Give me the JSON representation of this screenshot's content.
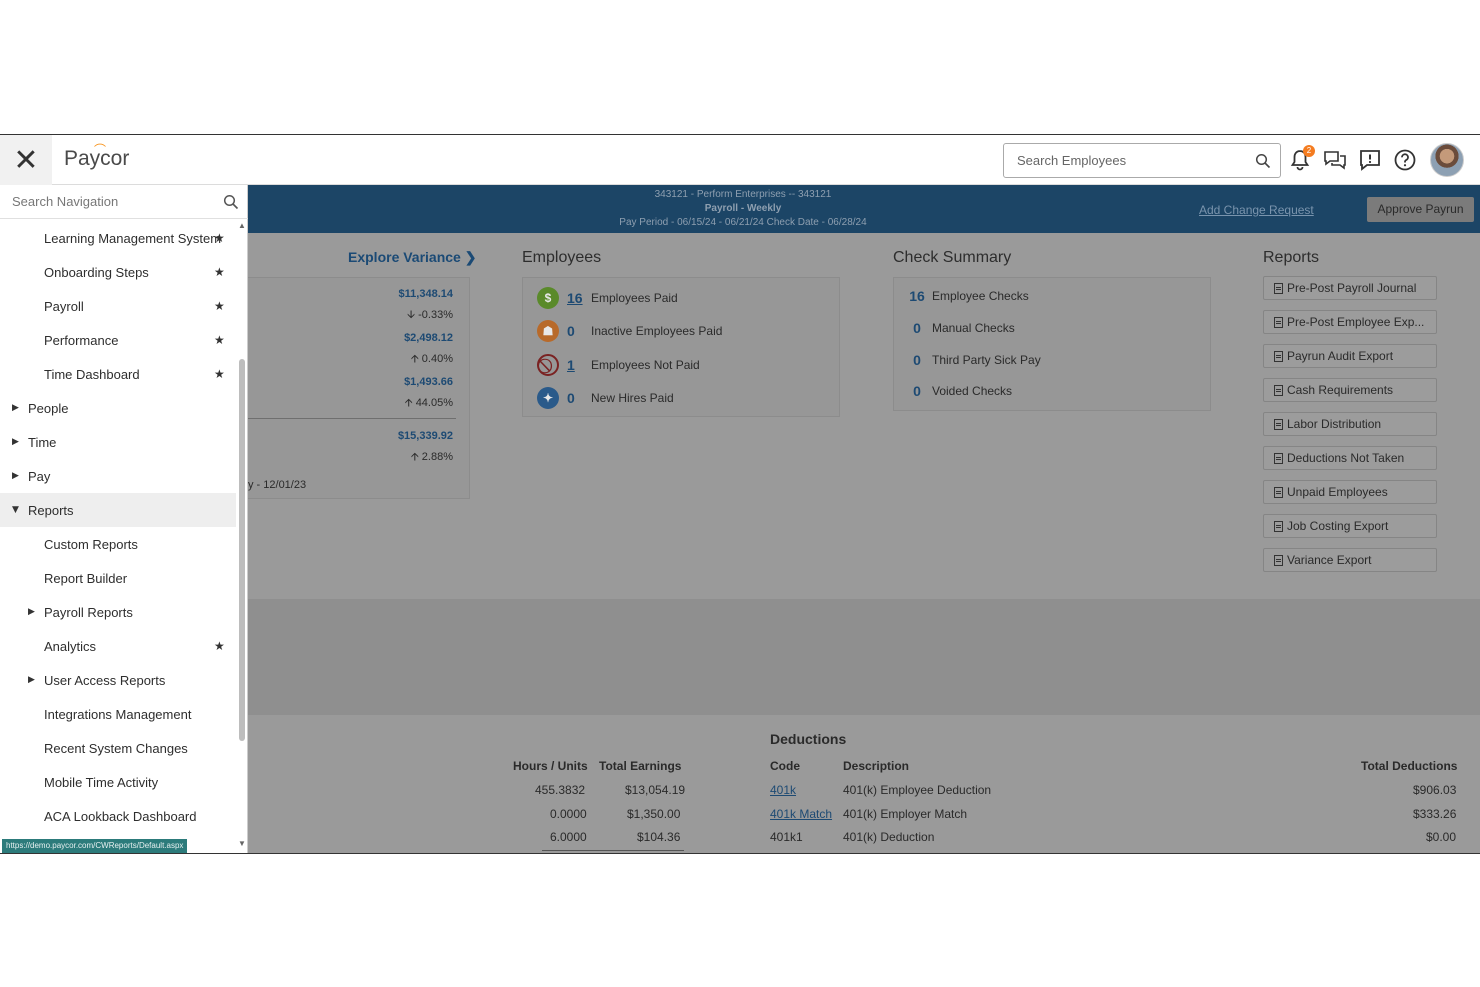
{
  "app": {
    "logo_text": "Paycor",
    "accent_color": "#f47c20"
  },
  "header": {
    "search_placeholder": "Search Employees",
    "notification_count": "2",
    "icons": [
      "bell-icon",
      "chat-icon",
      "feedback-icon",
      "help-icon"
    ]
  },
  "sidenav": {
    "search_placeholder": "Search Navigation",
    "items": [
      {
        "label": "Learning Management System",
        "starred": true
      },
      {
        "label": "Onboarding Steps",
        "starred": true
      },
      {
        "label": "Payroll",
        "starred": true
      },
      {
        "label": "Performance",
        "starred": true
      },
      {
        "label": "Time Dashboard",
        "starred": true
      },
      {
        "label": "People",
        "expanded": false
      },
      {
        "label": "Time",
        "expanded": false
      },
      {
        "label": "Pay",
        "expanded": false
      },
      {
        "label": "Reports",
        "expanded": true
      },
      {
        "label": "Custom Reports"
      },
      {
        "label": "Report Builder"
      },
      {
        "label": "Payroll Reports",
        "expanded": false
      },
      {
        "label": "Analytics",
        "starred": true
      },
      {
        "label": "User Access Reports",
        "expanded": false
      },
      {
        "label": "Integrations Management"
      },
      {
        "label": "Recent System Changes"
      },
      {
        "label": "Mobile Time Activity"
      },
      {
        "label": "ACA Lookback Dashboard"
      }
    ],
    "status_url": "https://demo.paycor.com/CWReports/Default.aspx"
  },
  "payrun": {
    "company_line": "343121 - Perform Enterprises -- 343121",
    "payroll_line": "Payroll - Weekly",
    "period_line": "Pay Period - 06/15/24 - 06/21/24    Check Date - 06/28/24",
    "add_change_label": "Add Change Request",
    "approve_label": "Approve Payrun"
  },
  "variance": {
    "explore_label": "Explore Variance",
    "rows": [
      {
        "amount": "$11,348.14",
        "change": "-0.33%",
        "direction": "down"
      },
      {
        "amount": "$2,498.12",
        "change": "0.40%",
        "direction": "up"
      },
      {
        "amount": "$1,493.66",
        "change": "44.05%",
        "direction": "up"
      },
      {
        "amount": "$15,339.92",
        "change": "2.88%",
        "direction": "up"
      }
    ],
    "footer": "y - 12/01/23"
  },
  "employees": {
    "title": "Employees",
    "rows": [
      {
        "count": "16",
        "label": "Employees Paid",
        "icon": "dollar-icon",
        "color": "#5a8a2a",
        "link": true
      },
      {
        "count": "0",
        "label": "Inactive Employees Paid",
        "icon": "inactive-employee-icon",
        "color": "#b86a2a",
        "link": false
      },
      {
        "count": "1",
        "label": "Employees Not Paid",
        "icon": "not-paid-icon",
        "color": "#8a2a2a",
        "link": true
      },
      {
        "count": "0",
        "label": "New Hires Paid",
        "icon": "new-hire-icon",
        "color": "#2a5a8a",
        "link": false
      }
    ]
  },
  "check_summary": {
    "title": "Check Summary",
    "rows": [
      {
        "count": "16",
        "label": "Employee Checks"
      },
      {
        "count": "0",
        "label": "Manual Checks"
      },
      {
        "count": "0",
        "label": "Third Party Sick Pay"
      },
      {
        "count": "0",
        "label": "Voided Checks"
      }
    ]
  },
  "reports": {
    "title": "Reports",
    "buttons": [
      "Pre-Post Payroll Journal",
      "Pre-Post Employee Exp...",
      "Payrun Audit Export",
      "Cash Requirements",
      "Labor Distribution",
      "Deductions Not Taken",
      "Unpaid Employees",
      "Job Costing Export",
      "Variance Export"
    ]
  },
  "earnings": {
    "headers": [
      "Hours / Units",
      "Total Earnings"
    ],
    "rows": [
      [
        "455.3832",
        "$13,054.19"
      ],
      [
        "0.0000",
        "$1,350.00"
      ],
      [
        "6.0000",
        "$104.36"
      ]
    ]
  },
  "deductions": {
    "title": "Deductions",
    "headers": [
      "Code",
      "Description",
      "Total Deductions"
    ],
    "rows": [
      {
        "code": "401k",
        "description": "401(k) Employee Deduction",
        "total": "$906.03",
        "link": true
      },
      {
        "code": "401k Match",
        "description": "401(k) Employer Match",
        "total": "$333.26",
        "link": true
      },
      {
        "code": "401k1",
        "description": "401(k) Deduction",
        "total": "$0.00",
        "link": false
      }
    ]
  }
}
